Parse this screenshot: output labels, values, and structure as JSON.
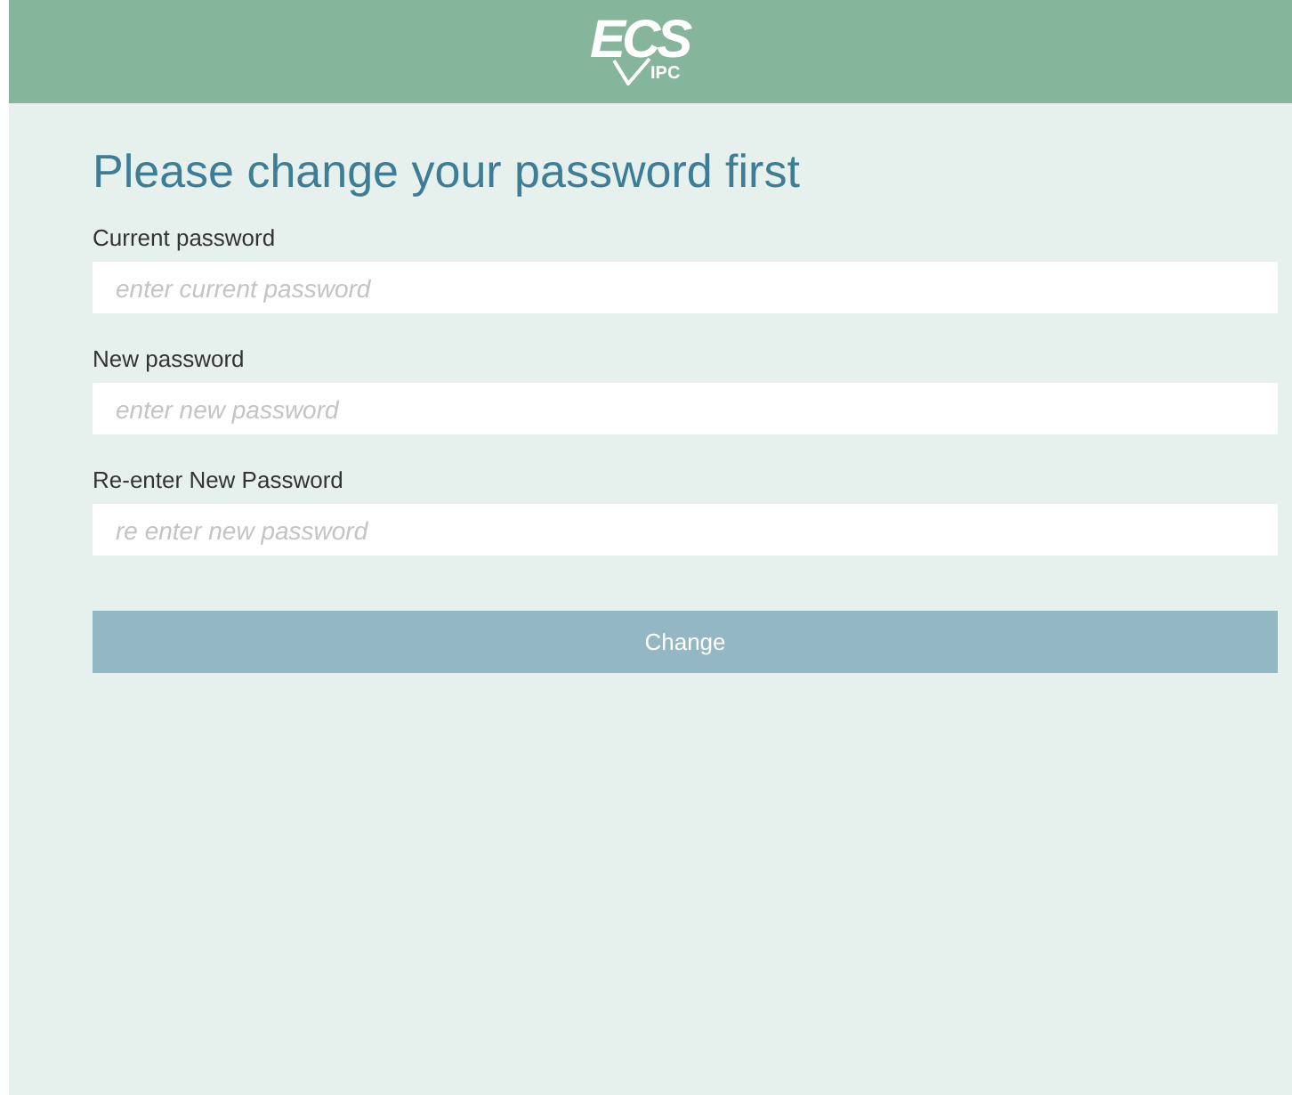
{
  "header": {
    "logo": {
      "main": "ECS",
      "sub": "IPC"
    }
  },
  "title": "Please change your password first",
  "fields": [
    {
      "label": "Current password",
      "placeholder": "enter current password"
    },
    {
      "label": "New password",
      "placeholder": "enter new password"
    },
    {
      "label": "Re-enter New Password",
      "placeholder": "re enter new password"
    }
  ],
  "button": {
    "label": "Change",
    "disabled": true
  }
}
